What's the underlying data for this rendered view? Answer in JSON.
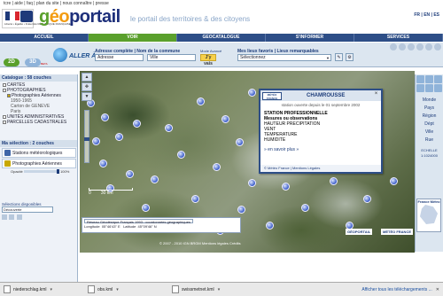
{
  "toplinks": "tcre | aide | faq | plan du site | nous connaître | presse",
  "brand": {
    "g": "g",
    "eo": "éo",
    "rest": "portail"
  },
  "rf_text": "Liberté • Égalité • Fraternité RÉPUBLIQUE FRANÇAISE",
  "tagline": "le portail des territoires & des citoyens",
  "lang": "FR | EN | ES",
  "nav": [
    {
      "label": "ACCUEIL"
    },
    {
      "label": "VOIR"
    },
    {
      "label": "GEOCATALOGUE"
    },
    {
      "label": "S'INFORMER"
    },
    {
      "label": "SERVICES"
    }
  ],
  "toolbar": {
    "btn_2d": "2D",
    "btn_3d": "3D",
    "beta": "BETA",
    "aller": "ALLER À",
    "addr_label": "Adresse complète | Nom de la commune",
    "addr_value": "Adresse",
    "commune_label": "",
    "commune_value": "Ville",
    "mode_avance": "Mode Avancé",
    "go": "J'y vais",
    "fav_label": "Mes lieux favoris | Lieux remarquables",
    "fav_value": "Sélectionnez"
  },
  "left": {
    "catalogue_title": "Catalogue : 58 couches",
    "tree": [
      {
        "label": "CARTES",
        "level": 0,
        "checked": false
      },
      {
        "label": "PHOTOGRAPHIES",
        "level": 0,
        "checked": false
      },
      {
        "label": "Photographies Aériennes",
        "level": 1,
        "checked": true
      },
      {
        "label": "1950-1965",
        "level": 2,
        "checked": false
      },
      {
        "label": "Carton de GENEVE",
        "level": 2,
        "checked": false
      },
      {
        "label": "Paris",
        "level": 2,
        "checked": false
      },
      {
        "label": "UNITÉS ADMINISTRATIVES",
        "level": 0,
        "checked": false
      },
      {
        "label": "PARCELLES CADASTRALES",
        "level": 0,
        "checked": false
      }
    ],
    "selection_title": "Ma sélection : 2 couches",
    "layers": [
      {
        "label": "Stations météorologiques"
      },
      {
        "label": "Photographies Aériennes"
      }
    ],
    "opacity_label": "Opacité",
    "opacity_value": "100%",
    "disp_title": "Sélections disponibles",
    "disp_value": "Découverte"
  },
  "popup": {
    "logo": "MÉTÉO FRANCE",
    "title": "CHAMROUSSE",
    "sub": "station ouverte depuis le 01 septembre 2002",
    "lines": [
      "STATION PROFESSIONNELLE",
      "Mesures ou observations",
      "HAUTEUR PRECIPITATION",
      "VENT",
      "TEMPERATURE",
      "HUMIDITE"
    ],
    "link": "» en savoir plus »",
    "foot": "© Météo France | Mentions Légales"
  },
  "map": {
    "scale_0": "0",
    "scale_km": "30 km",
    "coord_system": "Réseau Géodésique Français 1993 : coordonnées géographiques",
    "lon_label": "Longitude",
    "lon_value": "05°46'43\" E",
    "lat_label": "Latitude",
    "lat_value": "45°09'46\" N",
    "copyright": "© 2007 - 2010 IGN BRGM Mentions légales Crédits",
    "logo_a": "GÉOPORTAIL",
    "logo_b": "MÉTÉO FRANCE"
  },
  "right": {
    "list": [
      "Monde",
      "Pays",
      "Région",
      "Dépt",
      "Ville",
      "Rue"
    ],
    "echelle_label": "ECHELLE",
    "echelle_value": "1:1024000",
    "minimap_title": "France Métro"
  },
  "downloads": [
    {
      "name": "niederschlag.kml"
    },
    {
      "name": "obs.kml"
    },
    {
      "name": "swissmetnet.kml"
    }
  ],
  "downloads_all": "Afficher tous les téléchargements ..."
}
